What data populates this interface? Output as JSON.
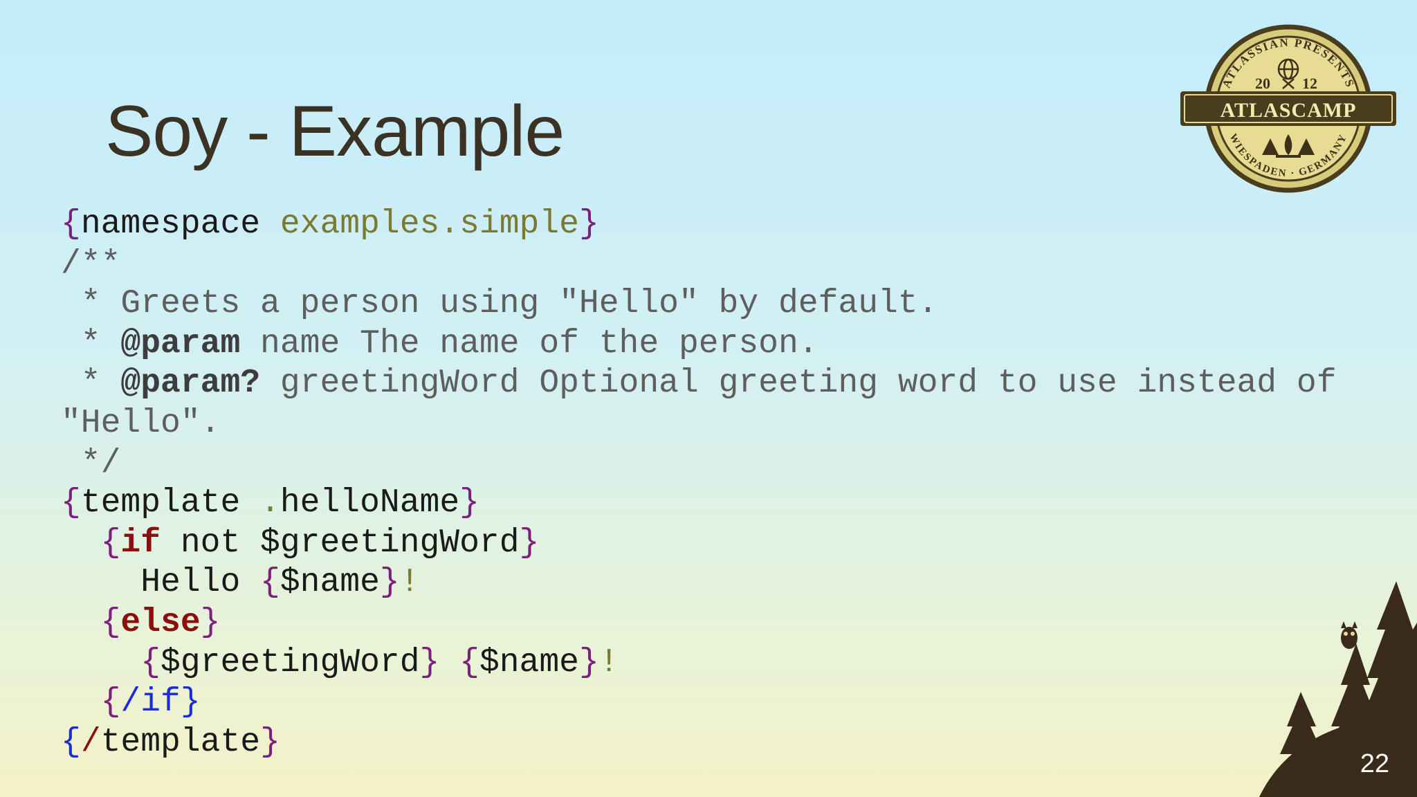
{
  "slide": {
    "title": "Soy - Example",
    "page_number": "22"
  },
  "badge": {
    "top_text": "ATLASSIAN PRESENTS",
    "year_left": "20",
    "year_right": "12",
    "banner": "ATLASCAMP",
    "bottom_text": "WIESPADEN · GERMANY"
  },
  "code": {
    "l1_open": "{",
    "l1_kw": "namespace",
    "l1_ns": "examples.simple",
    "l1_close": "}",
    "l2": "/**",
    "l3": " * Greets a person using \"Hello\" by default.",
    "l4_star": " * ",
    "l4_tag": "@param",
    "l4_text": " name The name of the person.",
    "l5_star": " * ",
    "l5_tag": "@param?",
    "l5_text": " greetingWord Optional greeting word to use instead of",
    "l6": "\"Hello\".",
    "l7": " */",
    "l8_open": "{",
    "l8_kw": "template",
    "l8_dot": ".",
    "l8_name": "helloName",
    "l8_close": "}",
    "l9_open": "{",
    "l9_kw": "if",
    "l9_text": " not $greetingWord",
    "l9_close": "}",
    "l10_text": "Hello ",
    "l10_open": "{",
    "l10_var": "$name",
    "l10_close": "}",
    "l10_excl": "!",
    "l11_open": "{",
    "l11_kw": "else",
    "l11_close": "}",
    "l12_open1": "{",
    "l12_var1": "$greetingWord",
    "l12_close1": "}",
    "l12_open2": "{",
    "l12_var2": "$name",
    "l12_close2": "}",
    "l12_excl": "!",
    "l13_open": "{",
    "l13_kw": "/if",
    "l13_close": "}",
    "l14_open": "{",
    "l14_slash": "/",
    "l14_kw": "template",
    "l14_close": "}"
  },
  "colors": {
    "title": "#3b3224",
    "brace": "#7d1f7d",
    "keyword": "#8a0f0f",
    "close_tag": "#1c2bd8",
    "namespace": "#7a7a30",
    "comment": "#5e5e5e"
  }
}
